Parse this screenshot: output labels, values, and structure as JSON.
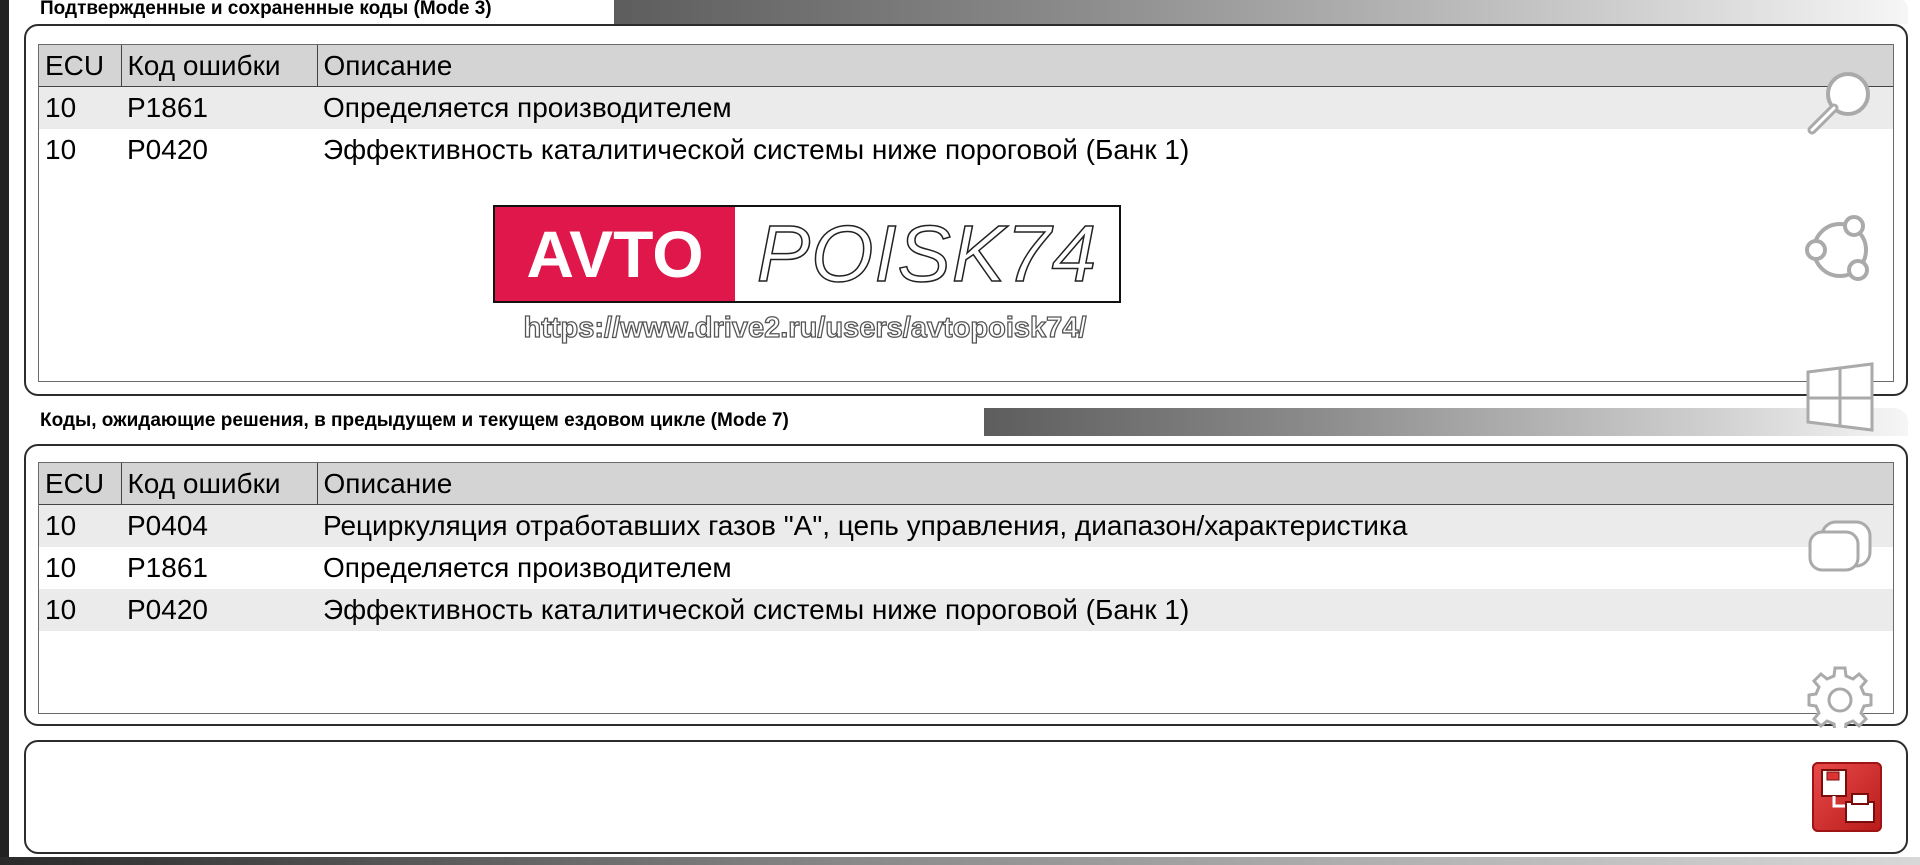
{
  "mode3": {
    "title": "Подтвержденные и сохраненные коды (Mode 3)",
    "headers": [
      "ECU",
      "Код ошибки",
      "Описание"
    ],
    "rows": [
      {
        "ecu": "10",
        "code": "P1861",
        "desc": "Определяется производителем"
      },
      {
        "ecu": "10",
        "code": "P0420",
        "desc": "Эффективность каталитической системы ниже пороговой (Банк 1)"
      }
    ]
  },
  "mode7": {
    "title": "Коды, ожидающие решения, в предыдущем и текущем ездовом цикле (Mode 7)",
    "headers": [
      "ECU",
      "Код ошибки",
      "Описание"
    ],
    "rows": [
      {
        "ecu": "10",
        "code": "P0404",
        "desc": "Рециркуляция отработавших газов \"A\", цепь управления, диапазон/характеристика"
      },
      {
        "ecu": "10",
        "code": "P1861",
        "desc": "Определяется производителем"
      },
      {
        "ecu": "10",
        "code": "P0420",
        "desc": "Эффективность каталитической системы ниже пороговой (Банк 1)"
      }
    ]
  },
  "watermark": {
    "brand_left": "AVTO",
    "brand_right": "POISK74",
    "url": "https://www.drive2.ru/users/avtopoisk74/"
  },
  "side_icons": [
    "search-icon",
    "share-icon",
    "windows-icon",
    "window-toggle-icon",
    "gear-icon"
  ],
  "colors": {
    "accent": "#e0174a",
    "save_button": "#d42a2a",
    "header_bg": "#d4d4d4",
    "row_alt": "#ebebeb"
  }
}
